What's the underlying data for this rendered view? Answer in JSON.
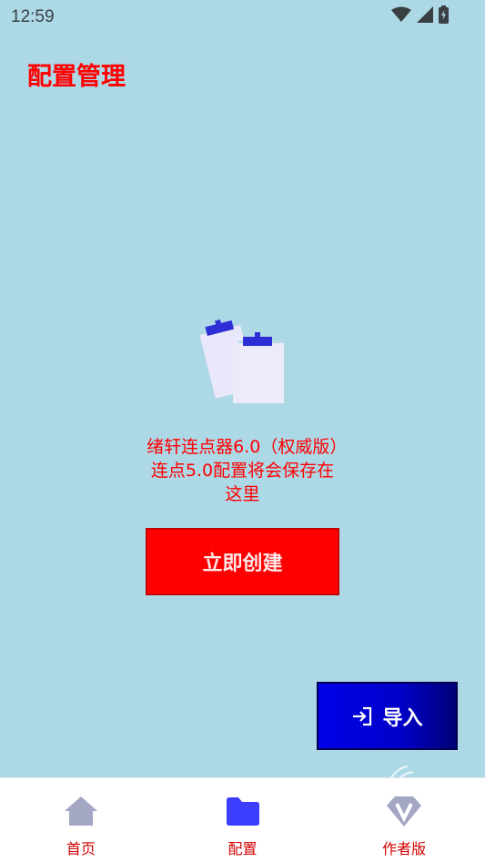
{
  "status_bar": {
    "time": "12:59",
    "icons": [
      "wifi-icon",
      "signal-icon",
      "battery-charging-icon"
    ]
  },
  "header": {
    "title": "配置管理"
  },
  "empty_state": {
    "icon": "clipboard-icon",
    "message": "绪轩连点器6.0（权威版）连点5.0配置将会保存在这里"
  },
  "actions": {
    "create_label": "立即创建",
    "import_label": "导入",
    "import_icon": "login-arrow-icon"
  },
  "bottom_nav": {
    "items": [
      {
        "label": "首页",
        "icon": "home-icon"
      },
      {
        "label": "配置",
        "icon": "folder-icon"
      },
      {
        "label": "作者版",
        "icon": "diamond-v-icon"
      }
    ]
  },
  "colors": {
    "background": "#add8e6",
    "accent_red": "#ff0000",
    "import_blue": "#0000cc",
    "nav_active": "#3d3dff",
    "nav_inactive": "#a3a7c4"
  }
}
